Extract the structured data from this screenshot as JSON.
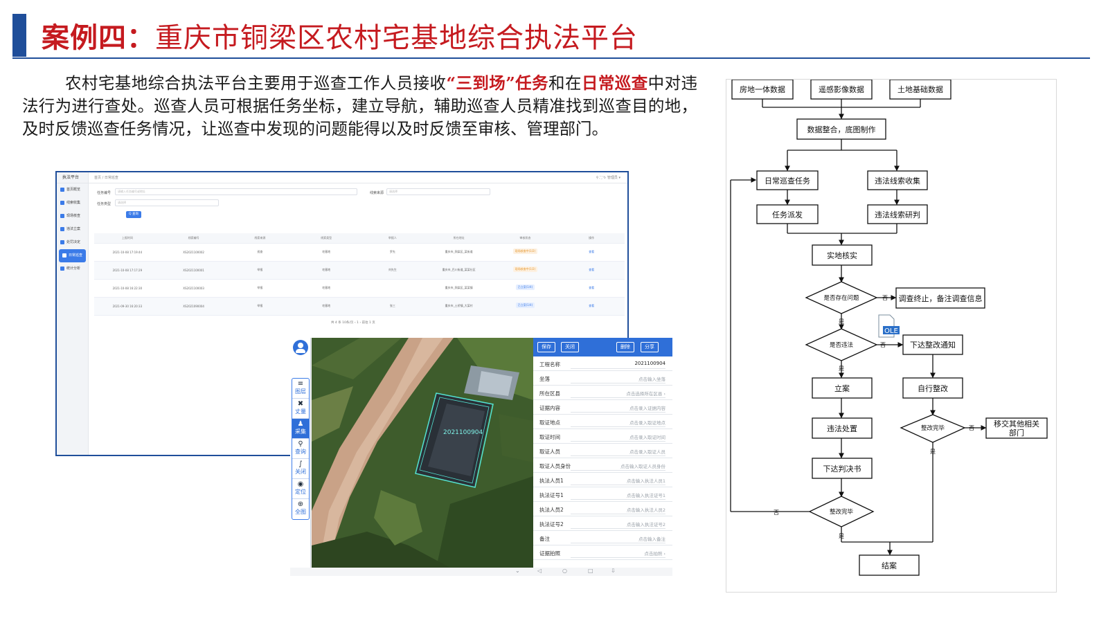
{
  "title": {
    "prefix": "案例四：",
    "main": "重庆市铜梁区农村宅基地综合执法平台"
  },
  "intro": {
    "p1": "农村宅基地综合执法平台主要用于巡查工作人员接收",
    "h1": "“三到场”任务",
    "p2": "和在",
    "h2": "日常巡查",
    "p3": "中对违法行为进行查处。巡查人员可根据任务坐标，建立导航，辅助巡查人员精准找到巡查目的地，及时反馈巡查任务情况，让巡查中发现的问题能得以及时反馈至审核、管理部门。"
  },
  "web": {
    "app_name": "执法平台",
    "breadcrumb": "首页 / 日常巡查",
    "nav": [
      "首页概览",
      "线索收集",
      "现场核查",
      "违法立案",
      "处罚决定",
      "日常巡查",
      "统计分析"
    ],
    "filters": {
      "task_no_label": "任务编号",
      "task_no_placeholder": "请输入任务编号或地址",
      "source_label": "线索来源",
      "source_placeholder": "请选择",
      "type_label": "任务类型",
      "type_placeholder": "请选择",
      "query_label": "Q 查询"
    },
    "columns": [
      "上报时间",
      "线索编号",
      "线索来源",
      "线索类型",
      "举报人",
      "所在地址",
      "审核状态",
      "操作"
    ],
    "rows": [
      {
        "time": "2021-10-08 17:19:44",
        "no": "XS2021100002",
        "source": "巡查",
        "type": "宅基地",
        "person": "罗先",
        "addr": "重庆市_铜梁区_某街道",
        "status": "现场核查中(1/2)",
        "status_color": "o",
        "op": "查看"
      },
      {
        "time": "2021-10-08 17:17:29",
        "no": "XS2021100001",
        "source": "举报",
        "type": "宅基地",
        "person": "刘先生",
        "addr": "重庆市_巴川街道_某某社区",
        "status": "现场核查中(1/2)",
        "status_color": "o",
        "op": "查看"
      },
      {
        "time": "2021-10-08 16:22:30",
        "no": "XS2021100003",
        "source": "举报",
        "type": "宅基地",
        "person": "",
        "addr": "重庆市_铜梁区_某某镇",
        "status": "已立案(1/4)",
        "status_color": "b",
        "op": "查看"
      },
      {
        "time": "2021-09-30 16:20:33",
        "no": "XS2021090004",
        "source": "举报",
        "type": "宅基地",
        "person": "张三",
        "addr": "重庆市_土桥镇_大某村",
        "status": "已立案(1/4)",
        "status_color": "b",
        "op": "查看"
      }
    ],
    "pager": "共 4 条    10条/页    ‹  1  ›    前往  1  页"
  },
  "tablet": {
    "tools": [
      {
        "icon": "≡",
        "label": "图层"
      },
      {
        "icon": "✖",
        "label": "丈量"
      },
      {
        "icon": "♟",
        "label": "采集"
      },
      {
        "icon": "⚲",
        "label": "查询"
      },
      {
        "icon": "∫",
        "label": "关闭"
      },
      {
        "icon": "◉",
        "label": "定位"
      },
      {
        "icon": "⊕",
        "label": "全图"
      }
    ],
    "map_label": "2021100904",
    "form_buttons": [
      "保存",
      "关闭",
      "删除",
      "分享"
    ],
    "fields": [
      {
        "key": "工程名称",
        "value": "2021100904",
        "dark": true
      },
      {
        "key": "坐落",
        "value": "点击输入坐落"
      },
      {
        "key": "所在区县",
        "value": "点击选择所在区县  ›"
      },
      {
        "key": "证据内容",
        "value": "点击录入证据内容"
      },
      {
        "key": "取证地点",
        "value": "点击录入取证地点"
      },
      {
        "key": "取证时间",
        "value": "点击录入取证时间"
      },
      {
        "key": "取证人员",
        "value": "点击录入取证人员"
      },
      {
        "key": "取证人员身份",
        "value": "点击输入取证人员身份"
      },
      {
        "key": "执法人员1",
        "value": "点击输入执法人员1"
      },
      {
        "key": "执法证号1",
        "value": "点击输入执法证号1"
      },
      {
        "key": "执法人员2",
        "value": "点击输入执法人员2"
      },
      {
        "key": "执法证号2",
        "value": "点击输入执法证号2"
      },
      {
        "key": "备注",
        "value": "点击输入备注"
      },
      {
        "key": "证据拍照",
        "value": "点击拍照  ›"
      }
    ],
    "sysbar": [
      "⌄",
      "◁",
      "○",
      "□",
      "⇩"
    ]
  },
  "flow": {
    "boxes": {
      "src1": "房地一体数据",
      "src2": "遥感影像数据",
      "src3": "土地基础数据",
      "merge": "数据整合，底图制作",
      "patrol": "日常巡查任务",
      "collect": "违法线索收集",
      "dispatch": "任务派发",
      "judge": "违法线索研判",
      "verify": "实地核实",
      "stop": "调查终止，备注调查信息",
      "notice": "下达整改通知",
      "file": "立案",
      "self": "自行整改",
      "handle": "违法处置",
      "transfer": "移交其他相关部门",
      "decide": "下达判决书",
      "close": "结案"
    },
    "diamonds": {
      "problem": "是否存在问题",
      "illegal": "是否违法",
      "fixed1": "整改完毕",
      "fixed2": "整改完毕"
    },
    "labels": {
      "yes": "是",
      "no": "否",
      "ole": "OLE"
    }
  }
}
